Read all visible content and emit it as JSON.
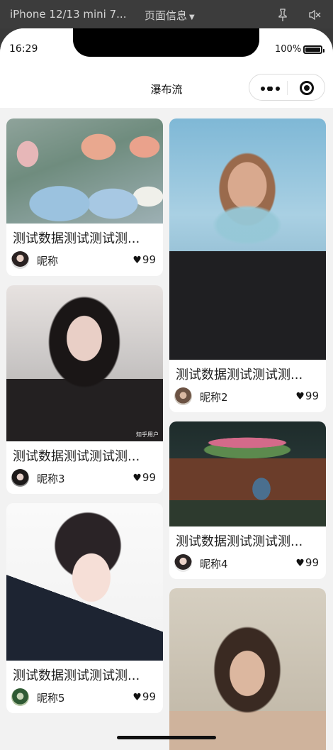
{
  "devtools": {
    "device": "iPhone 12/13 mini 7...",
    "page_info": "页面信息",
    "pin_icon": "pin-icon",
    "mute_icon": "mute-icon"
  },
  "status_bar": {
    "time": "16:29",
    "battery_percent": "100%",
    "battery_level": 1.0
  },
  "navbar": {
    "title": "瀑布流",
    "more_icon": "more-dots-icon",
    "close_icon": "capsule-target-icon"
  },
  "feed": {
    "left": [
      {
        "caption": "测试数据测试测试测...",
        "nickname": "昵称",
        "likes": "99",
        "image": "flowers-photo",
        "avatar": "avatar-1"
      },
      {
        "caption": "测试数据测试测试测...",
        "nickname": "昵称3",
        "likes": "99",
        "image": "girl-portrait-3",
        "avatar": "avatar-3"
      },
      {
        "caption": "测试数据测试测试测...",
        "nickname": "昵称5",
        "likes": "99",
        "image": "girl-illustration-5",
        "avatar": "avatar-5"
      }
    ],
    "right": [
      {
        "caption": "测试数据测试测试测...",
        "nickname": "昵称2",
        "likes": "99",
        "image": "smoke-woman-photo",
        "avatar": "avatar-2"
      },
      {
        "caption": "测试数据测试测试测...",
        "nickname": "昵称4",
        "likes": "99",
        "image": "piano-photo",
        "avatar": "avatar-4"
      },
      {
        "image": "girl-portrait-6"
      }
    ]
  },
  "heart_glyph": "♥",
  "watermark": "知乎用户"
}
